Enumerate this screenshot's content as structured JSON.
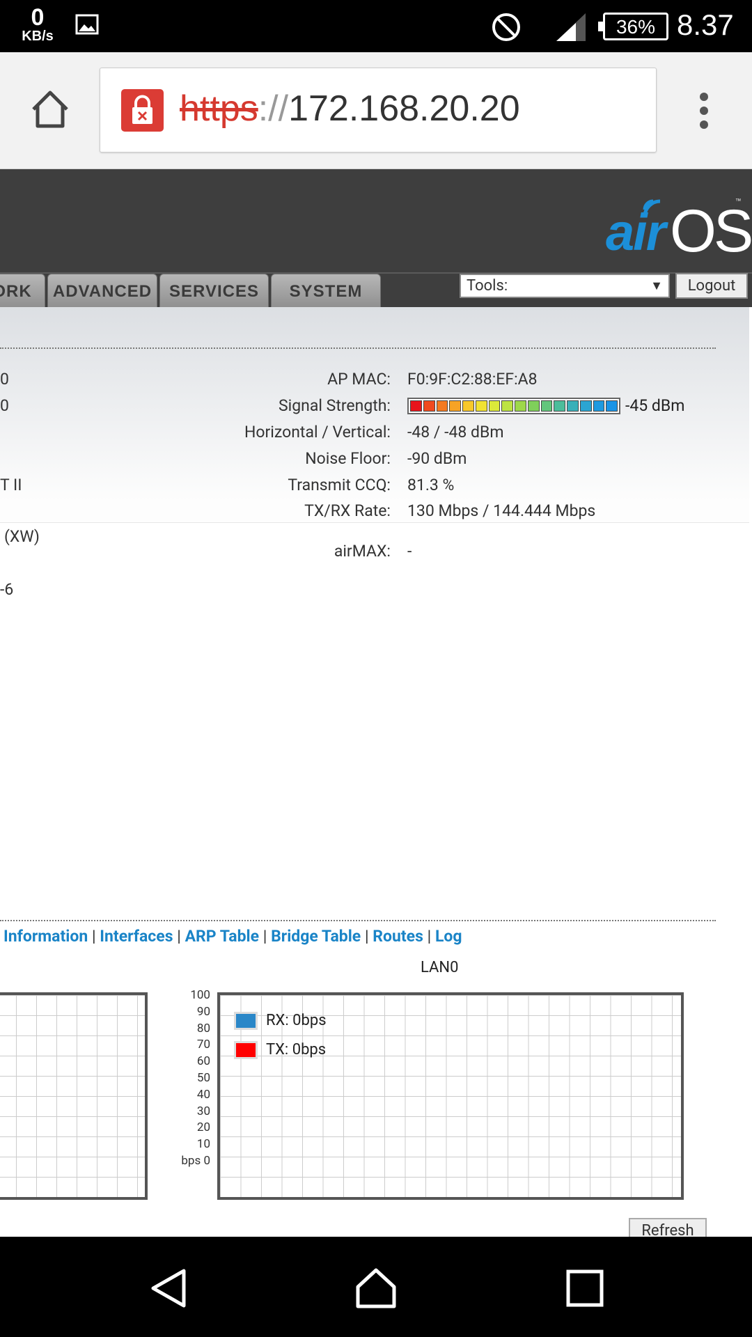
{
  "status_bar": {
    "net_speed_value": "0",
    "net_speed_unit": "KB/s",
    "battery": "36%",
    "time": "8.37",
    "icons": [
      "image-icon",
      "do-not-disturb-icon",
      "signal-icon",
      "battery-icon"
    ]
  },
  "browser": {
    "url_scheme": "https",
    "url_sep": "://",
    "url_host": "172.168.20.20"
  },
  "airos": {
    "logo_air": "air",
    "logo_os": "OS",
    "logo_tm": "™",
    "tabs": [
      "ORK",
      "ADVANCED",
      "SERVICES",
      "SYSTEM"
    ],
    "tools_label": "Tools:",
    "logout_label": "Logout"
  },
  "info": {
    "left_fragments": [
      "0",
      "0",
      "T II",
      "(XW)",
      "-6"
    ],
    "ap_mac_label": "AP MAC:",
    "ap_mac": "F0:9F:C2:88:EF:A8",
    "signal_label": "Signal Strength:",
    "signal_value": "-45 dBm",
    "hv_label": "Horizontal / Vertical:",
    "hv_value": "-48 / -48 dBm",
    "noise_label": "Noise Floor:",
    "noise_value": "-90 dBm",
    "ccq_label": "Transmit CCQ:",
    "ccq_value": "81.3 %",
    "rate_label": "TX/RX Rate:",
    "rate_value": "130 Mbps / 144.444 Mbps",
    "airmax_label": "airMAX:",
    "airmax_value": "-"
  },
  "links": [
    "Information",
    "Interfaces",
    "ARP Table",
    "Bridge Table",
    "Routes",
    "Log"
  ],
  "link_separator": "|",
  "chart": {
    "title": "LAN0",
    "y_ticks": [
      "100",
      "90",
      "80",
      "70",
      "60",
      "50",
      "40",
      "30",
      "20",
      "10",
      "bps 0"
    ],
    "legend": [
      {
        "label": "RX: 0bps",
        "color": "#2a87c8"
      },
      {
        "label": "TX: 0bps",
        "color": "#ff0000"
      }
    ]
  },
  "chart_data": {
    "type": "line",
    "title": "LAN0",
    "ylim": [
      0,
      100
    ],
    "series": [
      {
        "name": "RX: 0bps",
        "values": []
      },
      {
        "name": "TX: 0bps",
        "values": []
      }
    ],
    "grid": true,
    "legend_position": "top-left"
  },
  "refresh_label": "Refresh",
  "signal_colors": [
    "#e8141c",
    "#f04a1f",
    "#f47a21",
    "#f7a325",
    "#f8c82a",
    "#f1e232",
    "#dbe93a",
    "#bde342",
    "#9ed84a",
    "#7fcf5a",
    "#63c67c",
    "#4cbd9b",
    "#3ab0b9",
    "#2ba5d2",
    "#1f9ae0",
    "#1a94e6"
  ]
}
